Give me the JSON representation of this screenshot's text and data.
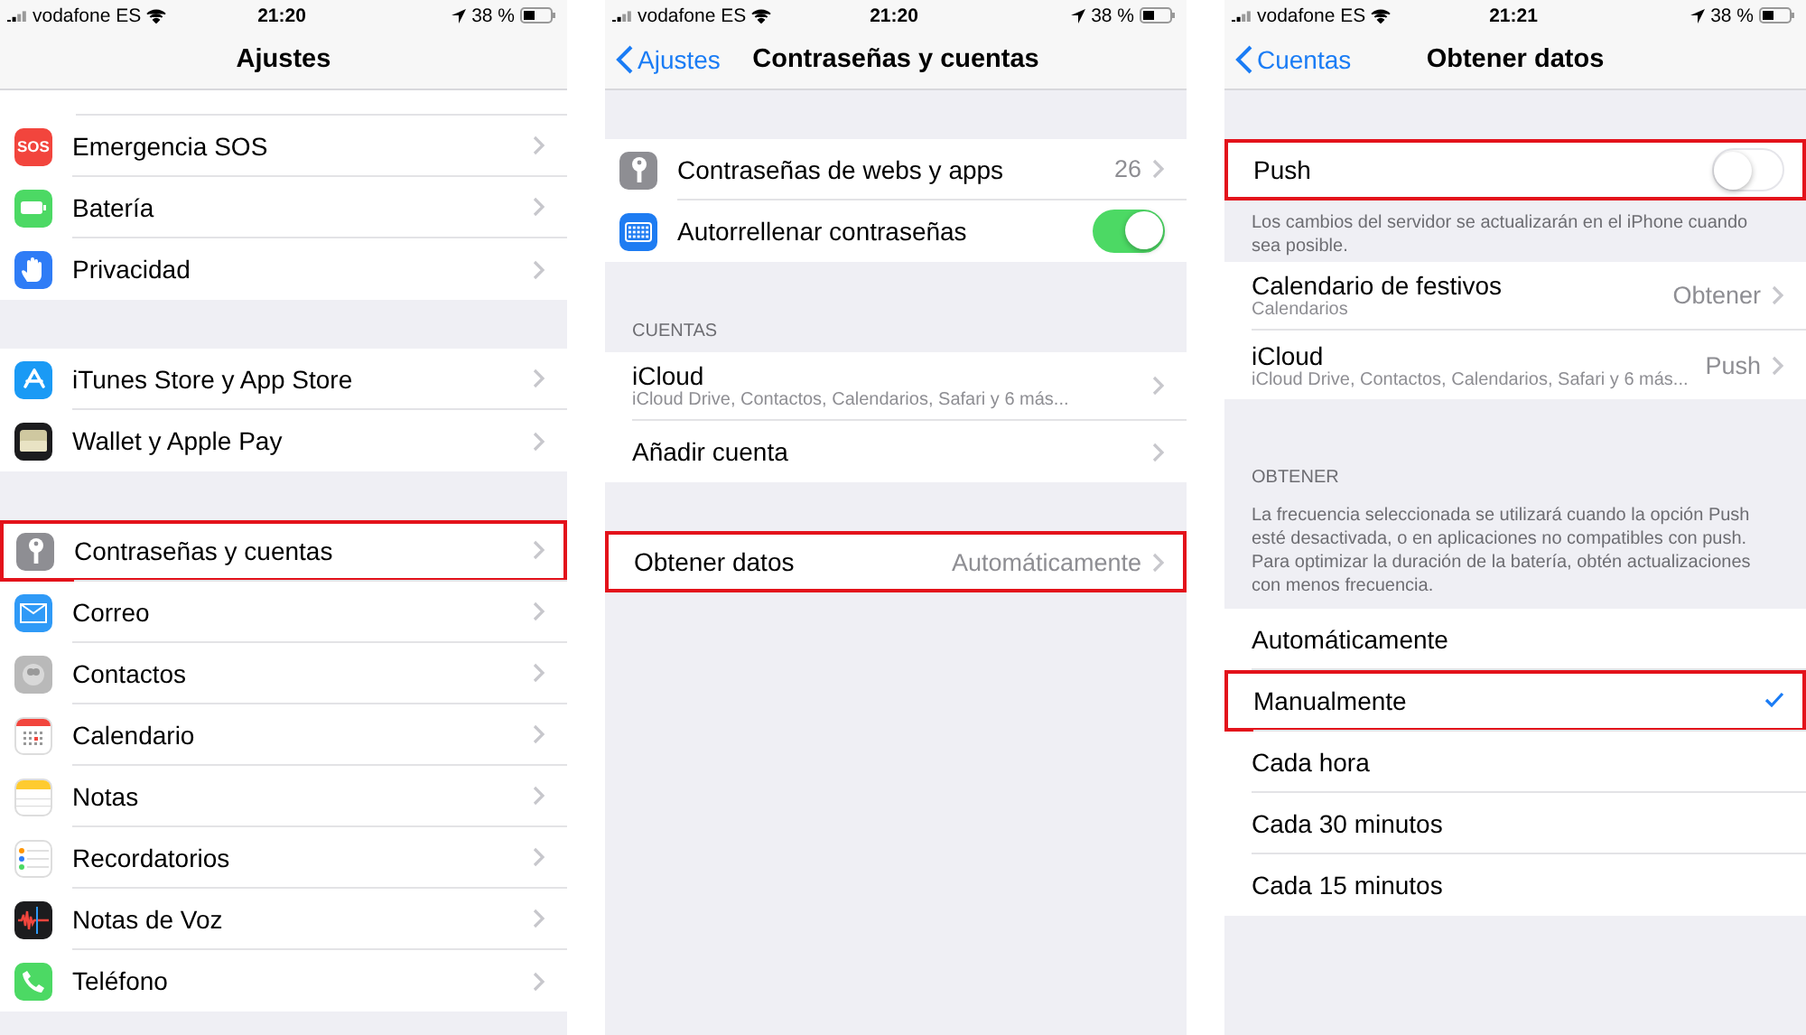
{
  "panels": [
    {
      "status": {
        "carrier": "vodafone ES",
        "time": "21:20",
        "battery": "38 %"
      },
      "nav": {
        "title": "Ajustes"
      },
      "sections": [
        {
          "clipped_top": true,
          "rows": [
            {
              "kind": "link",
              "label": "Emergencia SOS",
              "highlighted": false,
              "icon": {
                "kind": "sos",
                "color": "#f2453d",
                "text": "SOS"
              }
            },
            {
              "kind": "link",
              "label": "Batería",
              "highlighted": false,
              "icon": {
                "kind": "battery",
                "color": "#4cd964"
              }
            },
            {
              "kind": "link",
              "label": "Privacidad",
              "highlighted": false,
              "icon": {
                "kind": "hand",
                "color": "#2f7cf6"
              }
            }
          ]
        },
        {
          "rows": [
            {
              "kind": "link",
              "label": "iTunes Store y App Store",
              "highlighted": false,
              "icon": {
                "kind": "appstore",
                "color": "#1a9af5"
              }
            },
            {
              "kind": "link",
              "label": "Wallet y Apple Pay",
              "highlighted": false,
              "icon": {
                "kind": "wallet",
                "color": "#1c1c1e"
              }
            }
          ]
        },
        {
          "rows": [
            {
              "kind": "link",
              "label": "Contraseñas y cuentas",
              "highlighted": true,
              "icon": {
                "kind": "key",
                "color": "#8e8e93"
              }
            },
            {
              "kind": "link",
              "label": "Correo",
              "highlighted": false,
              "icon": {
                "kind": "mail",
                "color": "#2f9af7"
              }
            },
            {
              "kind": "link",
              "label": "Contactos",
              "highlighted": false,
              "icon": {
                "kind": "contacts",
                "color": "#b9b9b9"
              }
            },
            {
              "kind": "link",
              "label": "Calendario",
              "highlighted": false,
              "icon": {
                "kind": "calendar",
                "color": "#ffffff"
              }
            },
            {
              "kind": "link",
              "label": "Notas",
              "highlighted": false,
              "icon": {
                "kind": "notes",
                "color": "#ffffff"
              }
            },
            {
              "kind": "link",
              "label": "Recordatorios",
              "highlighted": false,
              "icon": {
                "kind": "reminders",
                "color": "#ffffff"
              }
            },
            {
              "kind": "link",
              "label": "Notas de Voz",
              "highlighted": false,
              "icon": {
                "kind": "voice",
                "color": "#1c1c1e"
              }
            },
            {
              "kind": "link",
              "label": "Teléfono",
              "highlighted": false,
              "icon": {
                "kind": "phone",
                "color": "#4cd964"
              }
            }
          ]
        }
      ]
    },
    {
      "status": {
        "carrier": "vodafone ES",
        "time": "21:20",
        "battery": "38 %"
      },
      "nav": {
        "back": "Ajustes",
        "title": "Contraseñas y cuentas"
      },
      "sections": [
        {
          "rows": [
            {
              "kind": "link",
              "label": "Contraseñas de webs y apps",
              "value": "26",
              "highlighted": false,
              "icon": {
                "kind": "key",
                "color": "#8e8e93"
              }
            },
            {
              "kind": "toggle",
              "label": "Autorrellenar contraseñas",
              "on": true,
              "highlighted": false,
              "icon": {
                "kind": "keyboard",
                "color": "#1e7cf2"
              }
            }
          ]
        },
        {
          "header": "CUENTAS",
          "rows": [
            {
              "kind": "link",
              "label": "iCloud",
              "subtitle": "iCloud Drive, Contactos, Calendarios, Safari y 6 más...",
              "highlighted": false
            },
            {
              "kind": "link",
              "label": "Añadir cuenta",
              "highlighted": false
            }
          ]
        },
        {
          "rows": [
            {
              "kind": "link",
              "label": "Obtener datos",
              "value": "Automáticamente",
              "highlighted": true
            }
          ]
        }
      ]
    },
    {
      "status": {
        "carrier": "vodafone ES",
        "time": "21:21",
        "battery": "38 %"
      },
      "nav": {
        "back": "Cuentas",
        "title": "Obtener datos"
      },
      "sections": [
        {
          "rows": [
            {
              "kind": "toggle",
              "label": "Push",
              "on": false,
              "highlighted": true
            }
          ],
          "footer": "Los cambios del servidor se actualizarán en el iPhone cuando sea posible."
        },
        {
          "rows": [
            {
              "kind": "link",
              "label": "Calendario de festivos",
              "subtitle": "Calendarios",
              "value": "Obtener",
              "highlighted": false
            },
            {
              "kind": "link",
              "label": "iCloud",
              "subtitle": "iCloud Drive, Contactos, Calendarios, Safari y 6 más...",
              "value": "Push",
              "highlighted": false
            }
          ]
        },
        {
          "header": "OBTENER",
          "header_note": "La frecuencia seleccionada se utilizará cuando la opción Push esté desactivada, o en aplicaciones no compatibles con push. Para optimizar la duración de la batería, obtén actualizaciones con menos frecuencia.",
          "rows": [
            {
              "kind": "option",
              "label": "Automáticamente",
              "selected": false,
              "highlighted": false
            },
            {
              "kind": "option",
              "label": "Manualmente",
              "selected": true,
              "highlighted": true
            },
            {
              "kind": "option",
              "label": "Cada hora",
              "selected": false,
              "highlighted": false
            },
            {
              "kind": "option",
              "label": "Cada 30 minutos",
              "selected": false,
              "highlighted": false
            },
            {
              "kind": "option",
              "label": "Cada 15 minutos",
              "selected": false,
              "highlighted": false
            }
          ]
        }
      ]
    }
  ]
}
